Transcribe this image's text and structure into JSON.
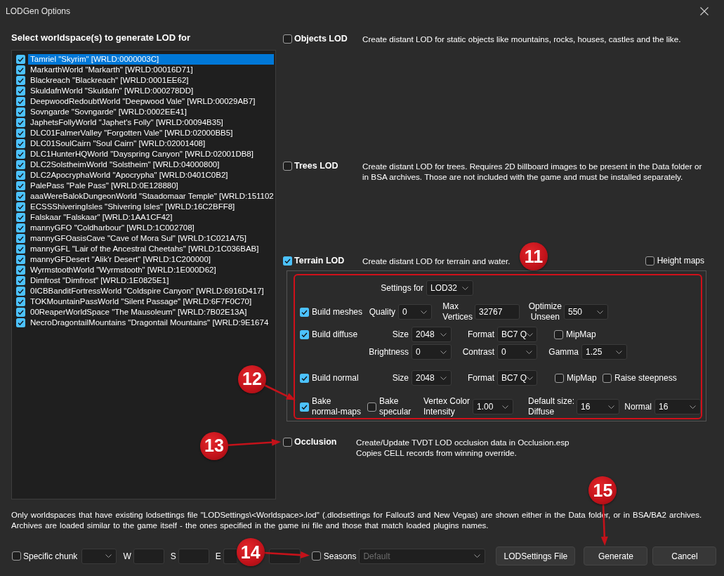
{
  "window": {
    "title": "LODGen Options"
  },
  "worldspaces": {
    "heading": "Select worldspace(s) to generate LOD for",
    "items": [
      {
        "label": "Tamriel \"Skyrim\" [WRLD:0000003C]",
        "checked": true,
        "selected": true
      },
      {
        "label": "MarkarthWorld \"Markarth\" [WRLD:00016D71]",
        "checked": true,
        "selected": false
      },
      {
        "label": "Blackreach \"Blackreach\" [WRLD:0001EE62]",
        "checked": true,
        "selected": false
      },
      {
        "label": "SkuldafnWorld \"Skuldafn\" [WRLD:000278DD]",
        "checked": true,
        "selected": false
      },
      {
        "label": "DeepwoodRedoubtWorld \"Deepwood Vale\" [WRLD:00029AB7]",
        "checked": true,
        "selected": false
      },
      {
        "label": "Sovngarde \"Sovngarde\" [WRLD:0002EE41]",
        "checked": true,
        "selected": false
      },
      {
        "label": "JaphetsFollyWorld \"Japhet's Folly\" [WRLD:00094B35]",
        "checked": true,
        "selected": false
      },
      {
        "label": "DLC01FalmerValley \"Forgotten Vale\" [WRLD:02000BB5]",
        "checked": true,
        "selected": false
      },
      {
        "label": "DLC01SoulCairn \"Soul Cairn\" [WRLD:02001408]",
        "checked": true,
        "selected": false
      },
      {
        "label": "DLC1HunterHQWorld \"Dayspring Canyon\" [WRLD:02001DB8]",
        "checked": true,
        "selected": false
      },
      {
        "label": "DLC2SolstheimWorld \"Solstheim\" [WRLD:04000800]",
        "checked": true,
        "selected": false
      },
      {
        "label": "DLC2ApocryphaWorld \"Apocrypha\" [WRLD:0401C0B2]",
        "checked": true,
        "selected": false
      },
      {
        "label": "PalePass \"Pale Pass\" [WRLD:0E128880]",
        "checked": true,
        "selected": false
      },
      {
        "label": "aaaWereBalokDungeonWorld \"Staadomaar Temple\" [WRLD:151102",
        "checked": true,
        "selected": false
      },
      {
        "label": "ECSSShiveringIsles \"Shivering Isles\" [WRLD:16C2BFF8]",
        "checked": true,
        "selected": false
      },
      {
        "label": "Falskaar \"Falskaar\" [WRLD:1AA1CF42]",
        "checked": true,
        "selected": false
      },
      {
        "label": "mannyGFO \"Coldharbour\" [WRLD:1C002708]",
        "checked": true,
        "selected": false
      },
      {
        "label": "mannyGFOasisCave \"Cave of Mora Sul\" [WRLD:1C021A75]",
        "checked": true,
        "selected": false
      },
      {
        "label": "mannyGFL \"Lair of the Ancestral Cheetahs\" [WRLD:1C036BAB]",
        "checked": true,
        "selected": false
      },
      {
        "label": "mannyGFDesert \"Alik'r Desert\" [WRLD:1C200000]",
        "checked": true,
        "selected": false
      },
      {
        "label": "WyrmstoothWorld \"Wyrmstooth\" [WRLD:1E000D62]",
        "checked": true,
        "selected": false
      },
      {
        "label": "Dimfrost \"Dimfrost\" [WRLD:1E0825E1]",
        "checked": true,
        "selected": false
      },
      {
        "label": "0ICBBanditFortressWorld \"Coldspire Canyon\" [WRLD:6916D417]",
        "checked": true,
        "selected": false
      },
      {
        "label": "TOKMountainPassWorld \"Silent Passage\" [WRLD:6F7F0C70]",
        "checked": true,
        "selected": false
      },
      {
        "label": "00ReaperWorldSpace \"The Mausoleum\" [WRLD:7B02E13A]",
        "checked": true,
        "selected": false
      },
      {
        "label": "NecroDragontailMountains \"Dragontail Mountains\" [WRLD:9E1674",
        "checked": true,
        "selected": false
      }
    ]
  },
  "objects_lod": {
    "label": "Objects LOD",
    "checked": false,
    "description": "Create distant LOD for static objects like mountains, rocks, houses, castles and the like."
  },
  "trees_lod": {
    "label": "Trees LOD",
    "checked": false,
    "description": "Create distant LOD for trees. Requires 2D billboard images to be present in the Data folder or in BSA archives. Those are not included with the game and must be installed separately."
  },
  "terrain_lod": {
    "label": "Terrain LOD",
    "checked": true,
    "description": "Create distant LOD for terrain and water.",
    "callout": {
      "number": "11",
      "arrow": false
    },
    "height_maps": {
      "label": "Height maps",
      "checked": false
    },
    "settings": {
      "highlighted": true,
      "settings_for": {
        "label": "Settings for",
        "value": "LOD32"
      },
      "build_meshes": {
        "label": "Build meshes",
        "checked": true,
        "quality": {
          "label": "Quality",
          "value": "0"
        },
        "max_vertices": {
          "label": "Max\nVertices",
          "value": "32767"
        },
        "optimize_unseen": {
          "label": "Optimize\nUnseen",
          "value": "550"
        }
      },
      "build_diffuse": {
        "label": "Build diffuse",
        "checked": true,
        "size": {
          "label": "Size",
          "value": "2048"
        },
        "format": {
          "label": "Format",
          "value": "BC7 Q"
        },
        "mipmap": {
          "label": "MipMap",
          "checked": false
        },
        "brightness": {
          "label": "Brightness",
          "value": "0"
        },
        "contrast": {
          "label": "Contrast",
          "value": "0"
        },
        "gamma": {
          "label": "Gamma",
          "value": "1.25"
        }
      },
      "build_normal": {
        "label": "Build normal",
        "checked": true,
        "size": {
          "label": "Size",
          "value": "2048"
        },
        "format": {
          "label": "Format",
          "value": "BC7 Q"
        },
        "mipmap": {
          "label": "MipMap",
          "checked": false
        },
        "raise_steepness": {
          "label": "Raise steepness",
          "checked": false
        }
      },
      "bake_normal_maps": {
        "label": "Bake\nnormal-maps",
        "checked": true,
        "callout": {
          "number": "12",
          "arrow": true
        }
      },
      "bake_specular": {
        "label": "Bake\nspecular",
        "checked": false
      },
      "vertex_color_intensity": {
        "label": "Vertex Color\nIntensity",
        "value": "1.00"
      },
      "default_size_diffuse": {
        "label": "Default size:\nDiffuse",
        "value": "16"
      },
      "default_size_normal": {
        "label": "Normal",
        "value": "16"
      }
    }
  },
  "occlusion": {
    "label": "Occlusion",
    "checked": false,
    "description": "Create/Update TVDT LOD occlusion data in Occlusion.esp\nCopies CELL records from winning override.",
    "callout": {
      "number": "13",
      "arrow": true
    }
  },
  "notes": "Only worldspaces that have existing lodsettings file \"LODSettings\\<Worldspace>.lod\" (.dlodsettings for Fallout3 and New Vegas) are shown either in the Data folder, or in BSA/BA2 archives.\nArchives are loaded similar to the game itself - the ones specified in the game ini file and those that match loaded plugins names.",
  "bottom_bar": {
    "specific_chunk": {
      "label": "Specific chunk",
      "checked": false
    },
    "chunk_fields": [
      {
        "kind": "labeled",
        "label": "W"
      },
      {
        "kind": "labeled",
        "label": "S"
      },
      {
        "kind": "labeled",
        "label": "E"
      },
      {
        "kind": "covered"
      }
    ],
    "seasons": {
      "label": "Seasons",
      "checked": false,
      "callout": {
        "number": "14",
        "arrow": true
      }
    },
    "season_select": {
      "value": "Default",
      "disabled": true
    },
    "buttons": [
      {
        "label": "LODSettings File"
      },
      {
        "label": "Generate",
        "callout": {
          "number": "15",
          "arrow": true
        }
      },
      {
        "label": "Cancel"
      }
    ]
  }
}
